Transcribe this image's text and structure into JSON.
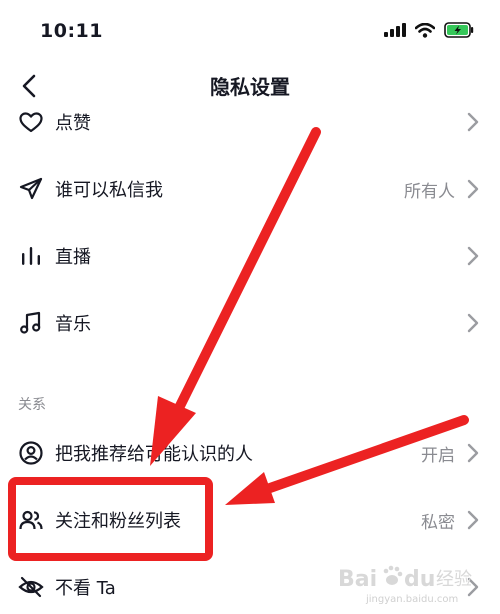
{
  "status": {
    "time": "10:11"
  },
  "header": {
    "title": "隐私设置"
  },
  "rows": [
    {
      "label": "点赞",
      "value": ""
    },
    {
      "label": "谁可以私信我",
      "value": "所有人"
    },
    {
      "label": "直播",
      "value": ""
    },
    {
      "label": "音乐",
      "value": ""
    },
    {
      "label": "把我推荐给可能认识的人",
      "value": "开启"
    },
    {
      "label": "关注和粉丝列表",
      "value": "私密"
    },
    {
      "label": "不看 Ta",
      "value": ""
    }
  ],
  "section": {
    "relations": "关系"
  },
  "watermark": {
    "brand": "Bai",
    "paw": "du",
    "jingyan": "经验",
    "url": "jingyan.baidu.com"
  },
  "annotation": {
    "color": "#ec2222"
  }
}
